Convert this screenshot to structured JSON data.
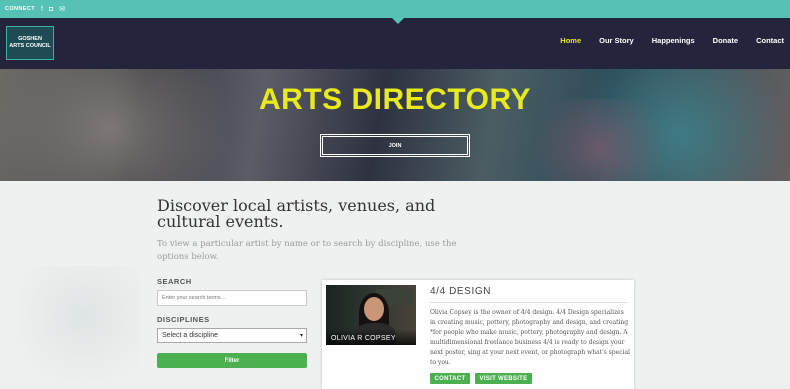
{
  "topbar": {
    "connect": "CONNECT",
    "icons": [
      "facebook-icon",
      "instagram-icon",
      "mail-icon"
    ],
    "glyphs": [
      "f",
      "◘",
      "✉"
    ]
  },
  "logo": {
    "line1": "GOSHEN",
    "line2": "ARTS COUNCIL"
  },
  "nav": {
    "items": [
      "Home",
      "Our Story",
      "Happenings",
      "Donate",
      "Contact"
    ],
    "active": "Home"
  },
  "hero": {
    "title": "ARTS DIRECTORY",
    "join_label": "JOIN"
  },
  "intro": {
    "title": "Discover local artists, venues, and cultural events.",
    "subtitle": "To view a particular artist by name or to search by discipline, use the options below."
  },
  "search": {
    "label": "SEARCH",
    "placeholder": "Enter your search terms..."
  },
  "disciplines": {
    "label": "DISCIPLINES",
    "selected": "Select a discipline"
  },
  "filter_label": "Filter",
  "card": {
    "photo_caption": "OLIVIA R COPSEY",
    "title": "4/4 DESIGN",
    "description": "Olivia Copsey is the owner of 4/4 design. 4/4 Design specializes in creating music, pottery, photography and design, and creating *for people who make music, pottery, photography and design. A multidimensional freelance business 4/4 is ready to design your next poster, sing at your next event, or photograph what's special to you.",
    "contact_label": "CONTACT",
    "website_label": "VISIT WEBSITE"
  },
  "colors": {
    "teal": "#56c1b5",
    "navy": "#24253c",
    "accent_yellow": "#e8ea1c",
    "green": "#4caf50"
  }
}
